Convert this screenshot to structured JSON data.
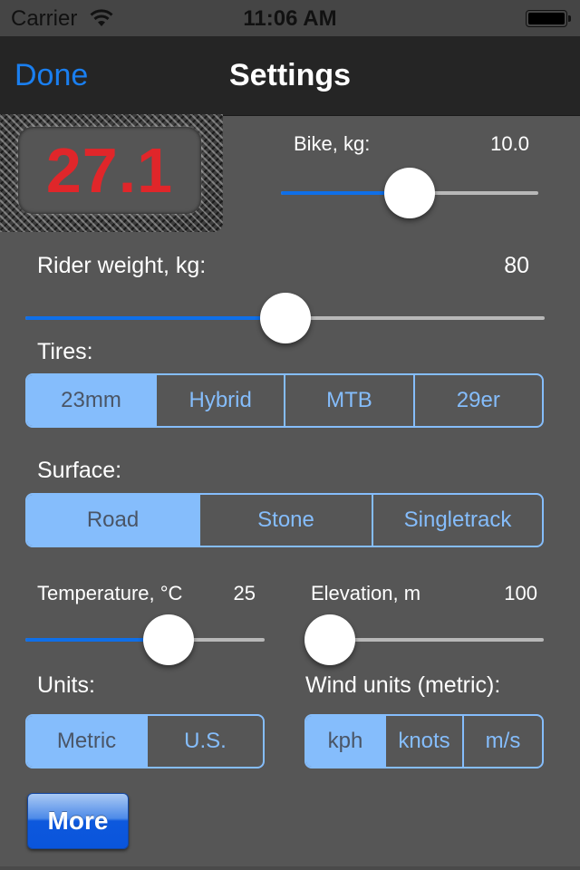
{
  "status_bar": {
    "carrier": "Carrier",
    "time": "11:06 AM",
    "wifi_icon": "wifi-icon",
    "battery_icon": "battery-icon",
    "battery_level": 1.0
  },
  "nav": {
    "done_label": "Done",
    "title": "Settings"
  },
  "speed_display": {
    "value": "27.1",
    "color": "#e0262a"
  },
  "bike": {
    "label": "Bike, kg:",
    "value": "10.0",
    "fraction": 0.5
  },
  "rider": {
    "label": "Rider weight, kg:",
    "value": "80",
    "fraction": 0.5
  },
  "tires": {
    "label": "Tires:",
    "options": [
      "23mm",
      "Hybrid",
      "MTB",
      "29er"
    ],
    "selected": 0
  },
  "surface": {
    "label": "Surface:",
    "options": [
      "Road",
      "Stone",
      "Singletrack"
    ],
    "selected": 0
  },
  "temperature": {
    "label": "Temperature, °C",
    "value": "25",
    "fraction": 0.6
  },
  "elevation": {
    "label": "Elevation, m",
    "value": "100",
    "fraction": 0.03
  },
  "units": {
    "label": "Units:",
    "options": [
      "Metric",
      "U.S."
    ],
    "selected": 0
  },
  "wind_units": {
    "label": "Wind units (metric):",
    "options": [
      "kph",
      "knots",
      "m/s"
    ],
    "selected": 0
  },
  "more_button": {
    "label": "More"
  },
  "colors": {
    "accent": "#1a7ff0",
    "slider_fill": "#0f6fe8",
    "segment": "#85bdfc",
    "background": "#565656"
  }
}
